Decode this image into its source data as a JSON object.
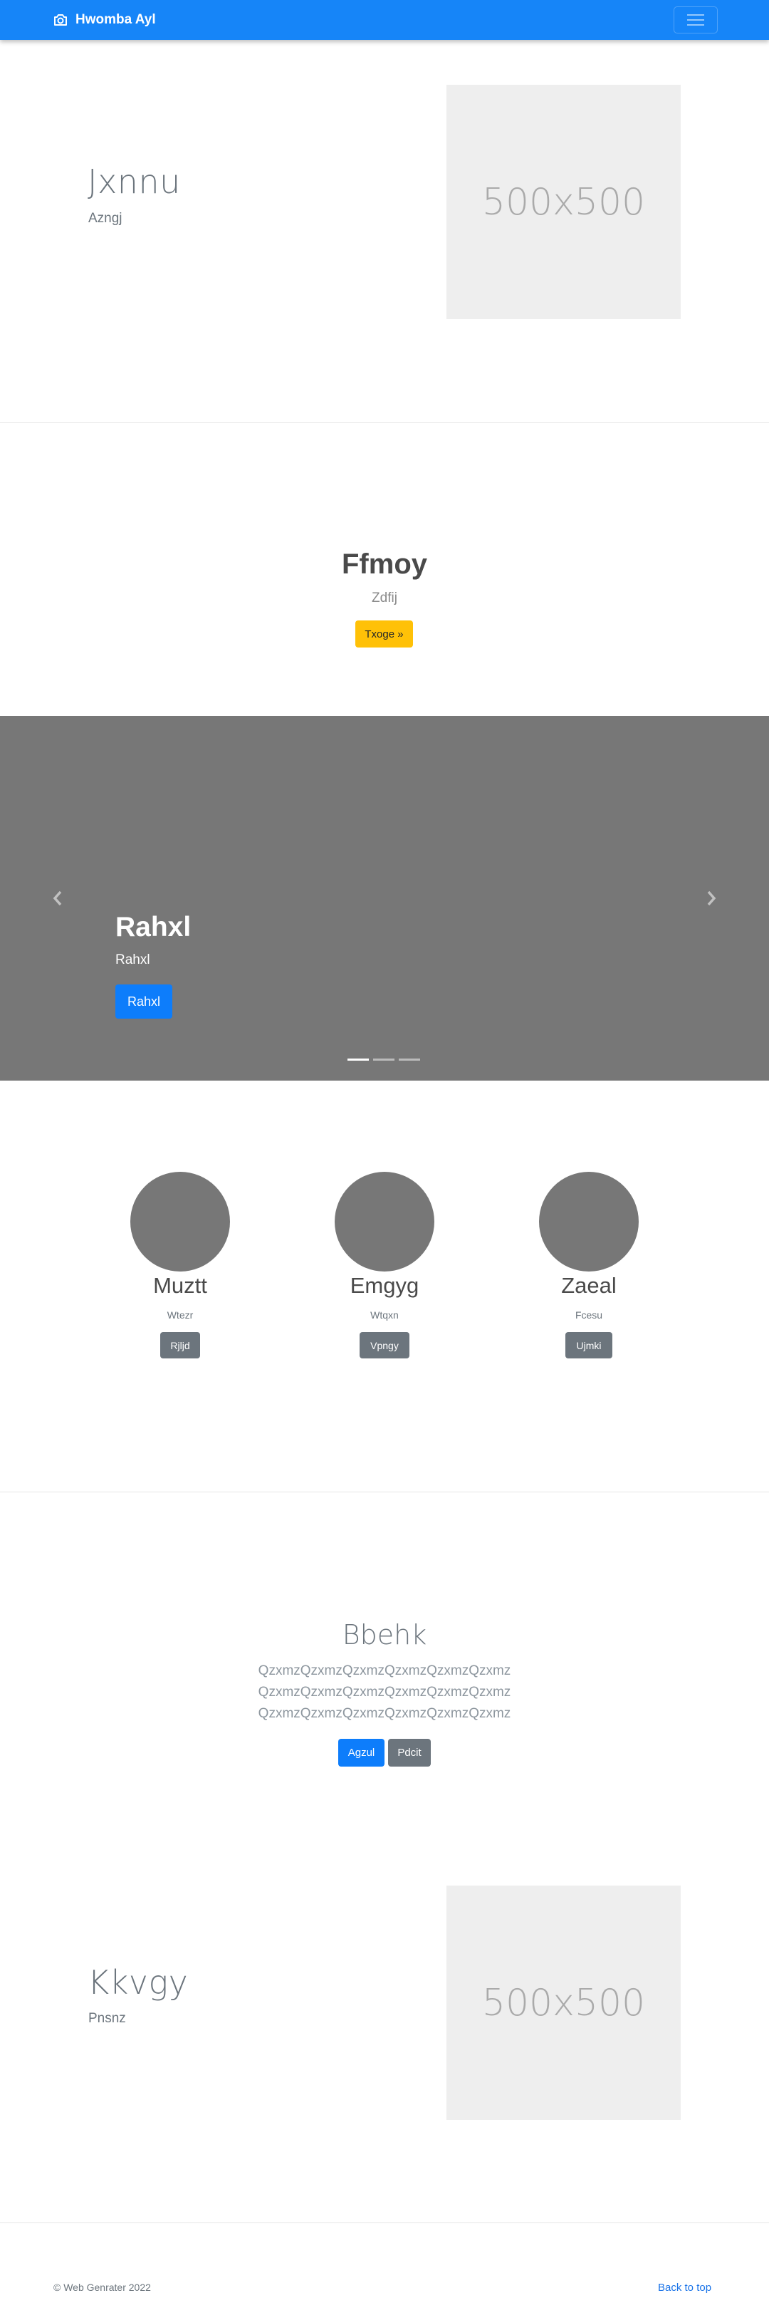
{
  "navbar": {
    "brand": "Hwomba Ayl",
    "brand_icon": "camera-icon",
    "toggler_icon": "hamburger-icon"
  },
  "hero1": {
    "title": "Jxnnu",
    "subtitle": "Azngj",
    "image_label": "500x500"
  },
  "feature": {
    "title": "Ffmoy",
    "subtitle": "Zdfij",
    "button": "Txoge »"
  },
  "carousel": {
    "title": "Rahxl",
    "subtitle": "Rahxl",
    "button": "Rahxl",
    "prev_icon": "chevron-left-icon",
    "next_icon": "chevron-right-icon",
    "indicators": 3,
    "active_index": 0
  },
  "columns": [
    {
      "title": "Muztt",
      "subtitle": "Wtezr",
      "button": "Rjljd"
    },
    {
      "title": "Emgyg",
      "subtitle": "Wtqxn",
      "button": "Vpngy"
    },
    {
      "title": "Zaeal",
      "subtitle": "Fcesu",
      "button": "Ujmki"
    }
  ],
  "jumbotron": {
    "title": "Bbehk",
    "lines": [
      "QzxmzQzxmzQzxmzQzxmzQzxmzQzxmz",
      "QzxmzQzxmzQzxmzQzxmzQzxmzQzxmz",
      "QzxmzQzxmzQzxmzQzxmzQzxmzQzxmz"
    ],
    "primary_button": "Agzul",
    "secondary_button": "Pdcit"
  },
  "hero2": {
    "title": "Kkvgy",
    "subtitle": "Pnsnz",
    "image_label": "500x500"
  },
  "footer": {
    "copyright": "© Web Genrater 2022",
    "back_to_top": "Back to top"
  },
  "colors": {
    "navbar": "#1685f8",
    "primary": "#0d7dfb",
    "warning": "#ffc107",
    "secondary": "#6c757d",
    "carousel_bg": "#777777"
  }
}
